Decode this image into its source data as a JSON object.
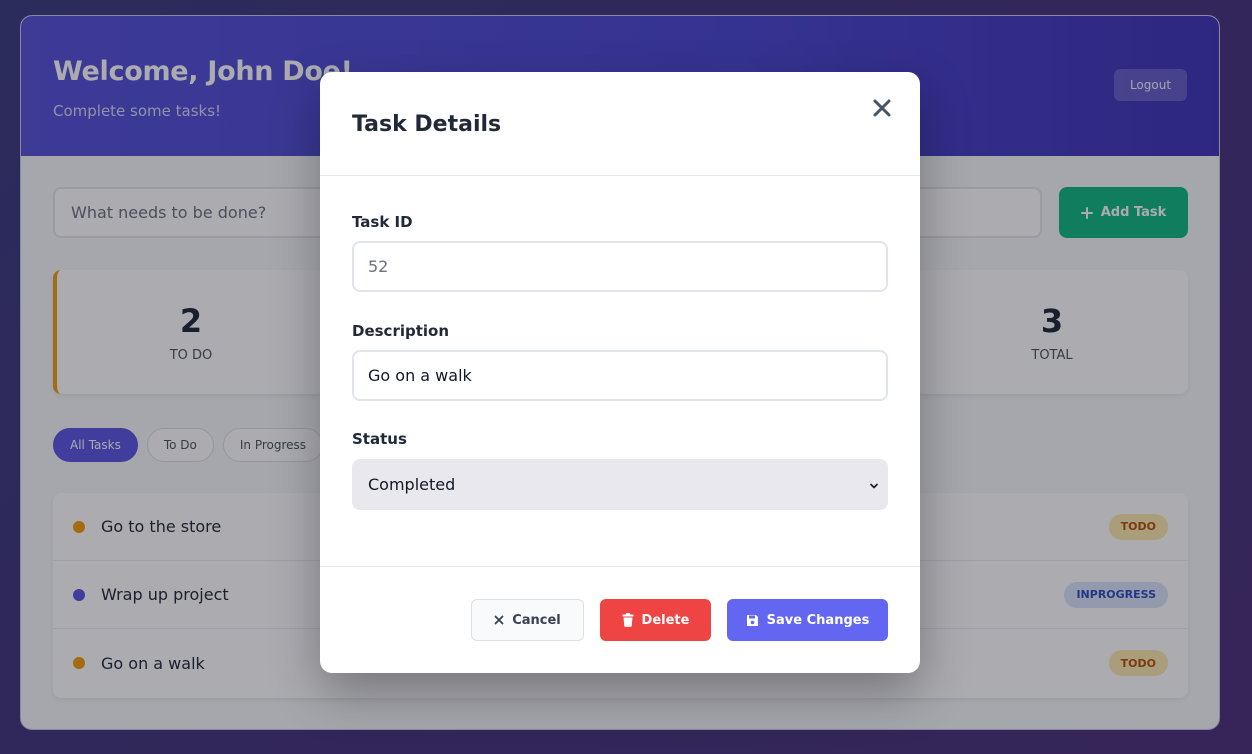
{
  "header": {
    "title": "Welcome, John Doe!",
    "subtitle": "Complete some tasks!",
    "logout_label": "Logout"
  },
  "add_task": {
    "placeholder": "What needs to be done?",
    "button_label": "Add Task"
  },
  "stats": {
    "todo": {
      "value": "2",
      "label": "TO DO"
    },
    "total": {
      "value": "3",
      "label": "TOTAL"
    }
  },
  "filters": [
    "All Tasks",
    "To Do",
    "In Progress"
  ],
  "tasks": [
    {
      "text": "Go to the store",
      "status": "TODO"
    },
    {
      "text": "Wrap up project",
      "status": "INPROGRESS"
    },
    {
      "text": "Go on a walk",
      "status": "TODO"
    }
  ],
  "modal": {
    "title": "Task Details",
    "task_id_label": "Task ID",
    "task_id_value": "52",
    "description_label": "Description",
    "description_value": "Go on a walk",
    "status_label": "Status",
    "status_value": "Completed",
    "cancel_label": "Cancel",
    "delete_label": "Delete",
    "save_label": "Save Changes"
  },
  "colors": {
    "primary": "#6366f1",
    "success": "#10b981",
    "danger": "#ef4444",
    "todo": "#f59e0b"
  }
}
